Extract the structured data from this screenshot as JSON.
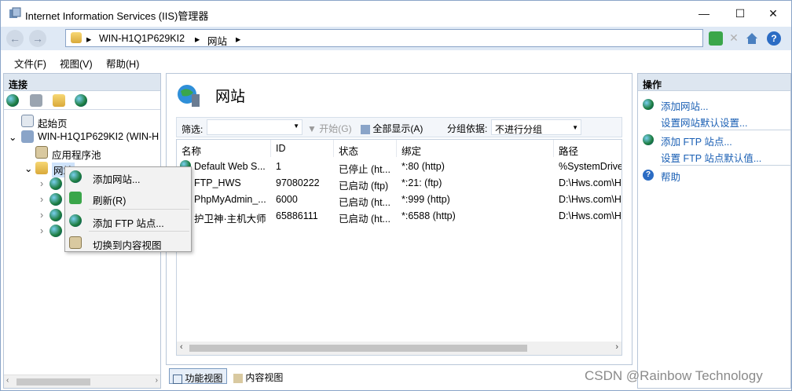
{
  "window": {
    "title": "Internet Information Services (IIS)管理器",
    "controls": {
      "minimize": "—",
      "maximize": "☐",
      "close": "✕"
    }
  },
  "address": {
    "back": "←",
    "forward": "→",
    "crumbs": [
      "WIN-H1Q1P629KI2",
      "网站"
    ],
    "separator": "▸"
  },
  "menu": {
    "file": "文件(F)",
    "view": "视图(V)",
    "help": "帮助(H)"
  },
  "left_panel": {
    "header": "连接",
    "tree": {
      "start_page": "起始页",
      "server": "WIN-H1Q1P629KI2 (WIN-H",
      "app_pools": "应用程序池",
      "sites": "网站"
    }
  },
  "context_menu": {
    "add_site": "添加网站...",
    "refresh": "刷新(R)",
    "add_ftp": "添加 FTP 站点...",
    "switch_content": "切换到内容视图"
  },
  "center": {
    "title": "网站",
    "filter": {
      "label": "筛选:",
      "value": "",
      "start": "开始(G)",
      "show_all": "全部显示(A)",
      "group_label": "分组依据:",
      "group_value": "不进行分组"
    },
    "columns": [
      "名称",
      "ID",
      "状态",
      "绑定",
      "路径"
    ],
    "rows": [
      {
        "name": "Default Web S...",
        "id": "1",
        "status": "已停止 (ht...",
        "binding": "*:80 (http)",
        "path": "%SystemDrive"
      },
      {
        "name": "FTP_HWS",
        "id": "97080222",
        "status": "已启动 (ftp)",
        "binding": "*:21: (ftp)",
        "path": "D:\\Hws.com\\H"
      },
      {
        "name": "PhpMyAdmin_...",
        "id": "6000",
        "status": "已启动 (ht...",
        "binding": "*:999 (http)",
        "path": "D:\\Hws.com\\H"
      },
      {
        "name": "护卫神·主机大师",
        "id": "65886111",
        "status": "已启动 (ht...",
        "binding": "*:6588 (http)",
        "path": "D:\\Hws.com\\H"
      }
    ],
    "view_tabs": {
      "features": "功能视图",
      "content": "内容视图"
    }
  },
  "right_panel": {
    "header": "操作",
    "actions": {
      "add_site": "添加网站...",
      "site_defaults": "设置网站默认设置...",
      "add_ftp": "添加 FTP 站点...",
      "ftp_defaults": "设置 FTP 站点默认值...",
      "help": "帮助"
    }
  },
  "watermark": "CSDN @Rainbow Technology"
}
